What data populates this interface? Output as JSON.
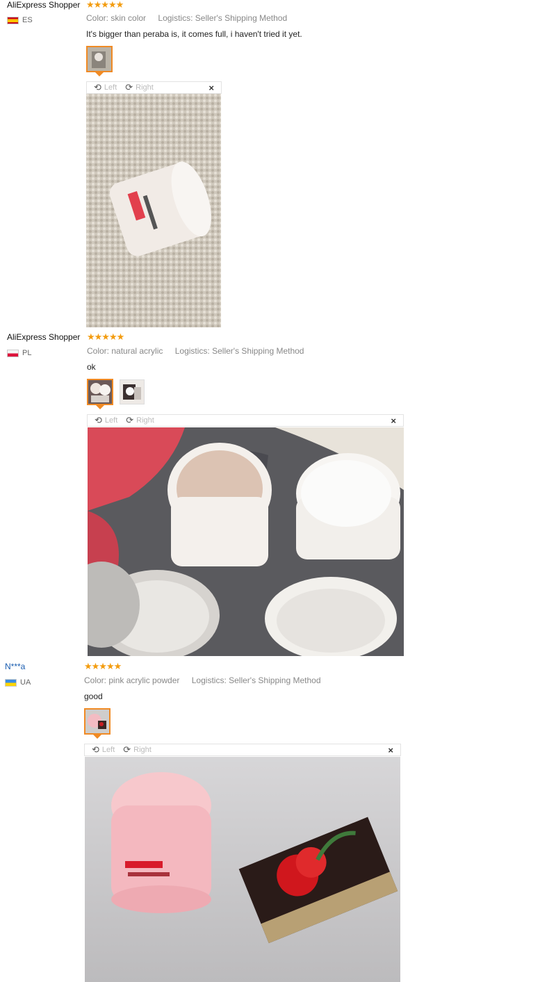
{
  "reviews": [
    {
      "reviewer": "AliExpress Shopper",
      "stars": "★★★★★",
      "country_code": "ES",
      "color_key": "Color:",
      "color_value": "skin color",
      "logistics_key": "Logistics:",
      "logistics_value": "Seller's Shipping Method",
      "text": "It's bigger than peraba is, it comes full, i haven't tried it yet.",
      "viewer": {
        "left": "Left",
        "right": "Right",
        "close": "×"
      }
    },
    {
      "reviewer": "AliExpress Shopper",
      "stars": "★★★★★",
      "country_code": "PL",
      "color_key": "Color:",
      "color_value": "natural acrylic",
      "logistics_key": "Logistics:",
      "logistics_value": "Seller's Shipping Method",
      "text": "ok",
      "viewer": {
        "left": "Left",
        "right": "Right",
        "close": "×"
      }
    },
    {
      "reviewer": "N***a",
      "stars": "★★★★★",
      "country_code": "UA",
      "color_key": "Color:",
      "color_value": "pink acrylic powder",
      "logistics_key": "Logistics:",
      "logistics_value": "Seller's Shipping Method",
      "text": "good",
      "viewer": {
        "left": "Left",
        "right": "Right",
        "close": "×"
      }
    }
  ],
  "icons": {
    "rotate_left": "rotate-left-icon",
    "rotate_right": "rotate-right-icon",
    "close": "close-icon"
  },
  "colors": {
    "accent": "#f08a24",
    "star": "#f39c0f",
    "link": "#1a5db0"
  }
}
